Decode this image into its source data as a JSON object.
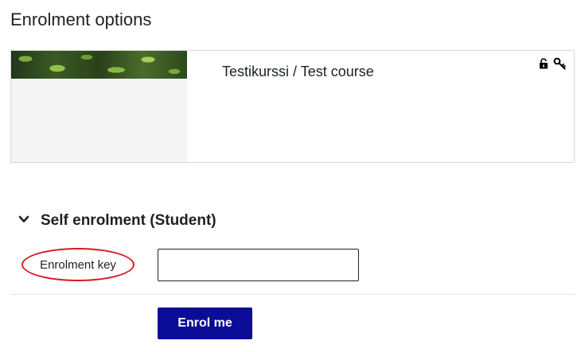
{
  "page": {
    "title": "Enrolment options"
  },
  "course": {
    "name": "Testikurssi / Test course",
    "icons": [
      "unlock-icon",
      "key-icon"
    ]
  },
  "enrolment": {
    "section_title": "Self enrolment (Student)",
    "key_label": "Enrolment key",
    "key_value": "",
    "submit_label": "Enrol me"
  },
  "colors": {
    "button_bg": "#0b0c98",
    "highlight_ring": "#d6181f",
    "text": "#1d2125"
  }
}
